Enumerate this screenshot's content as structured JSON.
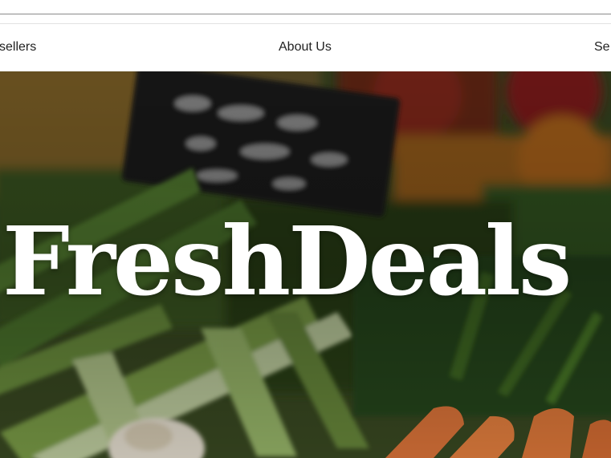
{
  "nav": {
    "items": [
      {
        "label": "sellers"
      },
      {
        "label": "About Us"
      },
      {
        "label": "Se"
      }
    ]
  },
  "hero": {
    "title": "FreshDeals",
    "background_icon": "vegetable-market-photo"
  },
  "colors": {
    "nav_text": "#222222",
    "hero_title": "#ffffff",
    "divider": "#8a8a8a"
  }
}
